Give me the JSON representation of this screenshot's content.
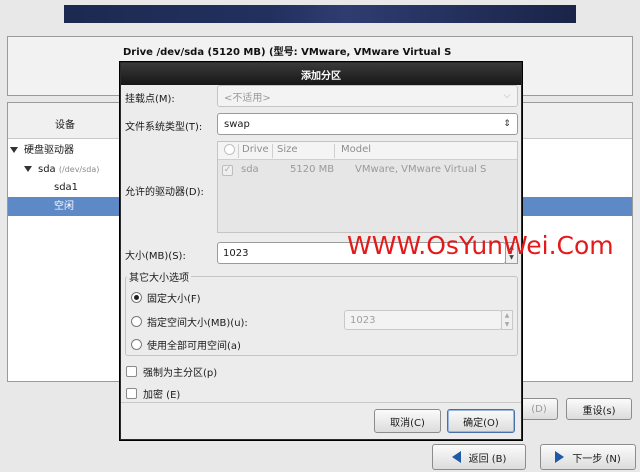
{
  "background": {
    "drive_title": "Drive /dev/sda (5120 MB) (型号: VMware, VMware Virtual S",
    "tree": {
      "column_device": "设备",
      "items": [
        {
          "label": "硬盘驱动器",
          "sub": ""
        },
        {
          "label": "sda",
          "sub": "(/dev/sda)"
        },
        {
          "label": "sda1",
          "sub": ""
        },
        {
          "label": "空闲",
          "sub": ""
        }
      ]
    },
    "buttons": {
      "delete_label": "(D)",
      "reset_label": "重设(s)",
      "back_label": "返回 (B)",
      "next_label": "下一步 (N)"
    }
  },
  "dialog": {
    "title": "添加分区",
    "mount_point": {
      "label": "挂载点(M):",
      "value": "<不适用>"
    },
    "fs_type": {
      "label": "文件系统类型(T):",
      "value": "swap"
    },
    "allowed_drives": {
      "label": "允许的驱动器(D):",
      "columns": [
        "Drive",
        "Size",
        "Model"
      ],
      "rows": [
        {
          "drive": "sda",
          "size": "5120 MB",
          "model": "VMware, VMware Virtual S",
          "checked": true
        }
      ]
    },
    "size": {
      "label": "大小(MB)(S):",
      "value": "1023"
    },
    "other_size_options": {
      "legend": "其它大小选项",
      "options": [
        {
          "label": "固定大小(F)",
          "selected": true
        },
        {
          "label": "指定空间大小(MB)(u):",
          "selected": false
        },
        {
          "label": "使用全部可用空间(a)",
          "selected": false
        }
      ],
      "max_value": "1023"
    },
    "force_primary": {
      "label": "强制为主分区(p)",
      "checked": false
    },
    "encrypt": {
      "label": "加密 (E)",
      "checked": false
    },
    "cancel_label": "取消(C)",
    "ok_label": "确定(O)"
  },
  "watermark": "WWW.OsYunWei.Com"
}
